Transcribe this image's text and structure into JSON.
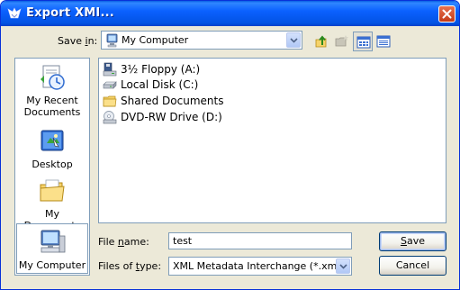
{
  "window": {
    "title": "Export XMI..."
  },
  "toolbar": {
    "save_in_label_pre": "Save ",
    "save_in_label_u": "i",
    "save_in_label_post": "n:",
    "location": "My Computer"
  },
  "places": [
    {
      "label": "My Recent Documents",
      "icon": "my-recent-documents-icon"
    },
    {
      "label": "Desktop",
      "icon": "desktop-icon"
    },
    {
      "label": "My Documents",
      "icon": "my-documents-icon"
    },
    {
      "label": "My Computer",
      "icon": "my-computer-icon"
    }
  ],
  "files": [
    {
      "name": "3½ Floppy (A:)",
      "icon": "floppy-drive-icon"
    },
    {
      "name": "Local Disk (C:)",
      "icon": "hard-disk-icon"
    },
    {
      "name": "Shared Documents",
      "icon": "folder-icon"
    },
    {
      "name": "DVD-RW Drive (D:)",
      "icon": "dvd-drive-icon"
    }
  ],
  "filename": {
    "label_pre": "File ",
    "label_u": "n",
    "label_post": "ame:",
    "value": "test"
  },
  "filetype": {
    "label_pre": "Files of ",
    "label_u": "t",
    "label_post": "ype:",
    "value": "XML Metadata Interchange (*.xmi)"
  },
  "buttons": {
    "save_u": "S",
    "save_rest": "ave",
    "cancel": "Cancel"
  },
  "colors": {
    "titlebar": "#0b61ff",
    "close": "#c43a17",
    "dialog": "#ece9d8"
  }
}
